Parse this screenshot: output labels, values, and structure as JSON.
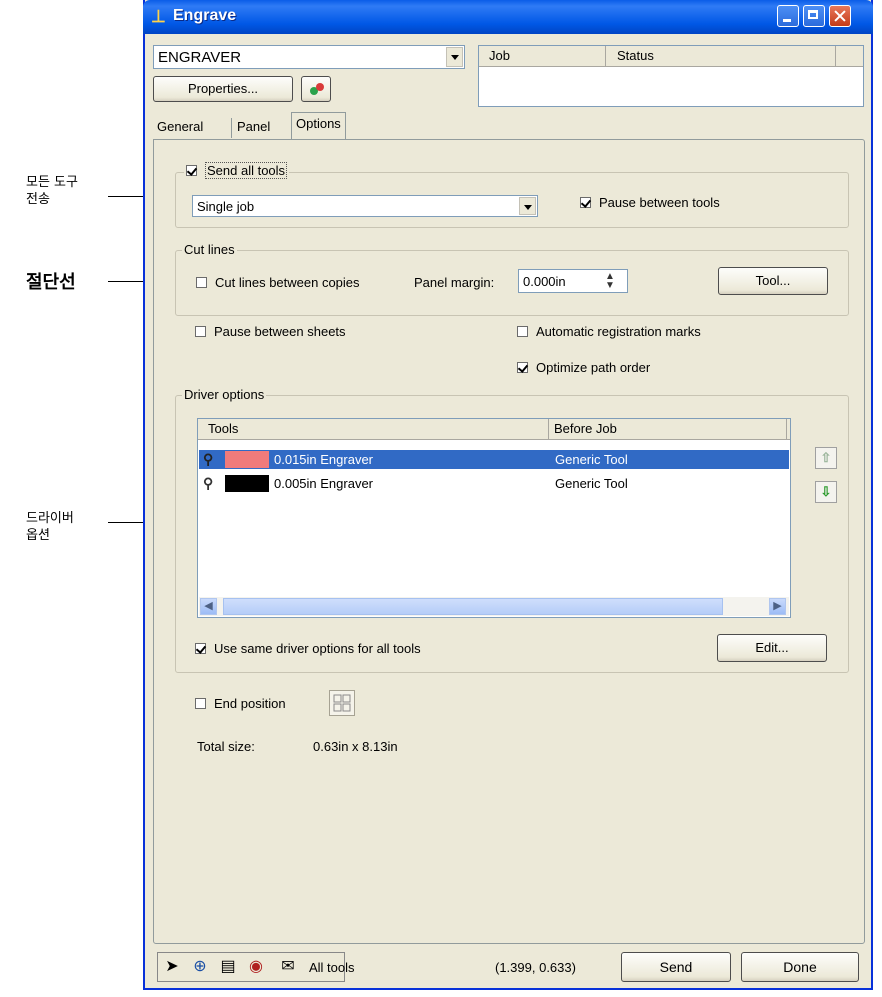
{
  "annotations": {
    "send_all": "모든 도구\n전송",
    "cut_lines": "절단선",
    "driver": "드라이버\n옵션"
  },
  "window": {
    "title": "Engrave",
    "icon": "engrave-app-icon"
  },
  "device": {
    "selected": "ENGRAVER",
    "properties_label": "Properties...",
    "properties_icon": "color-dots-icon"
  },
  "job_table": {
    "headers": [
      "Job",
      "Status"
    ]
  },
  "tabs": [
    {
      "label": "General",
      "active": false
    },
    {
      "label": "Panel",
      "active": false
    },
    {
      "label": "Options",
      "active": true
    }
  ],
  "send_all_tools": {
    "label": "Send all tools",
    "checked": true,
    "mode": "Single job",
    "pause_between_tools": {
      "label": "Pause between tools",
      "checked": true
    }
  },
  "cut_lines": {
    "title": "Cut lines",
    "between_copies": {
      "label": "Cut lines between copies",
      "checked": false
    },
    "panel_margin_label": "Panel margin:",
    "panel_margin_value": "0.000in",
    "tool_button": "Tool..."
  },
  "options": {
    "pause_between_sheets": {
      "label": "Pause between sheets",
      "checked": false
    },
    "auto_registration": {
      "label": "Automatic registration marks",
      "checked": false
    },
    "optimize_path": {
      "label": "Optimize path order",
      "checked": true
    }
  },
  "driver_options": {
    "title": "Driver options",
    "columns": [
      "Tools",
      "Before Job"
    ],
    "rows": [
      {
        "tool": "0.015in Engraver",
        "before_job": "Generic Tool",
        "color": "#f07b7b",
        "selected": true
      },
      {
        "tool": "0.005in Engraver",
        "before_job": "Generic Tool",
        "color": "#000000",
        "selected": false
      }
    ],
    "same_options": {
      "label": "Use same driver options for all tools",
      "checked": true
    },
    "edit_button": "Edit..."
  },
  "end_position": {
    "label": "End position",
    "checked": false
  },
  "total_size": {
    "label": "Total size:",
    "value": "0.63in x 8.13in"
  },
  "statusbar": {
    "tools_label": "All tools",
    "coords": "(1.399, 0.633)",
    "send_button": "Send",
    "done_button": "Done"
  }
}
